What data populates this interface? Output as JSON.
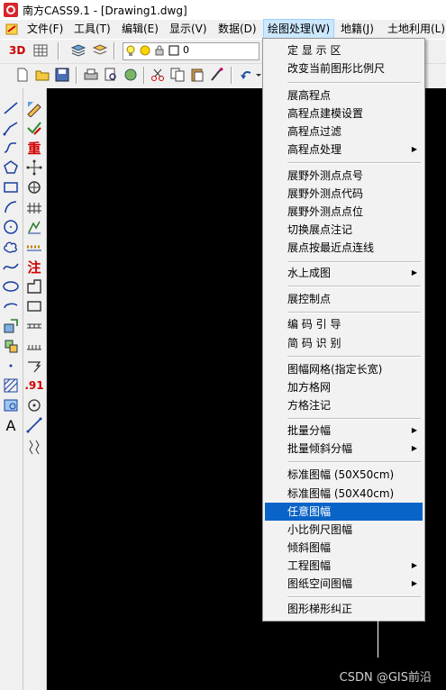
{
  "window": {
    "title": "南方CASS9.1 - [Drawing1.dwg]"
  },
  "menubar": {
    "items": [
      {
        "label": "文件(F)"
      },
      {
        "label": "工具(T)"
      },
      {
        "label": "编辑(E)"
      },
      {
        "label": "显示(V)"
      },
      {
        "label": "数据(D)"
      },
      {
        "label": "绘图处理(W)"
      },
      {
        "label": "地籍(J)"
      },
      {
        "label": "土地利用(L)"
      }
    ]
  },
  "toolbar": {
    "three_d_label": "3D",
    "layer_value": "0"
  },
  "left_toolbar": {
    "zhong": "重",
    "zhu": "注",
    "text_a": "A",
    "dot91": ".91"
  },
  "dropdown": {
    "items": [
      {
        "label": "定 显 示 区"
      },
      {
        "label": "改变当前图形比例尺"
      },
      {
        "label": "展高程点"
      },
      {
        "label": "高程点建模设置"
      },
      {
        "label": "高程点过滤"
      },
      {
        "label": "高程点处理"
      },
      {
        "label": "展野外测点点号"
      },
      {
        "label": "展野外测点代码"
      },
      {
        "label": "展野外测点点位"
      },
      {
        "label": "切换展点注记"
      },
      {
        "label": "展点按最近点连线"
      },
      {
        "label": "水上成图"
      },
      {
        "label": "展控制点"
      },
      {
        "label": "编 码 引 导"
      },
      {
        "label": "简 码 识 别"
      },
      {
        "label": "图幅网格(指定长宽)"
      },
      {
        "label": "加方格网"
      },
      {
        "label": "方格注记"
      },
      {
        "label": "批量分幅"
      },
      {
        "label": "批量倾斜分幅"
      },
      {
        "label": "标准图幅 (50X50cm)"
      },
      {
        "label": "标准图幅 (50X40cm)"
      },
      {
        "label": "任意图幅"
      },
      {
        "label": "小比例尺图幅"
      },
      {
        "label": "倾斜图幅"
      },
      {
        "label": "工程图幅"
      },
      {
        "label": "图纸空间图幅"
      },
      {
        "label": "图形梯形纠正"
      }
    ],
    "submenu_arrow": "▶"
  },
  "watermark": {
    "text": "CSDN @GIS前沿"
  },
  "colors": {
    "highlight": "#0a64c8",
    "canvas": "#000000"
  }
}
